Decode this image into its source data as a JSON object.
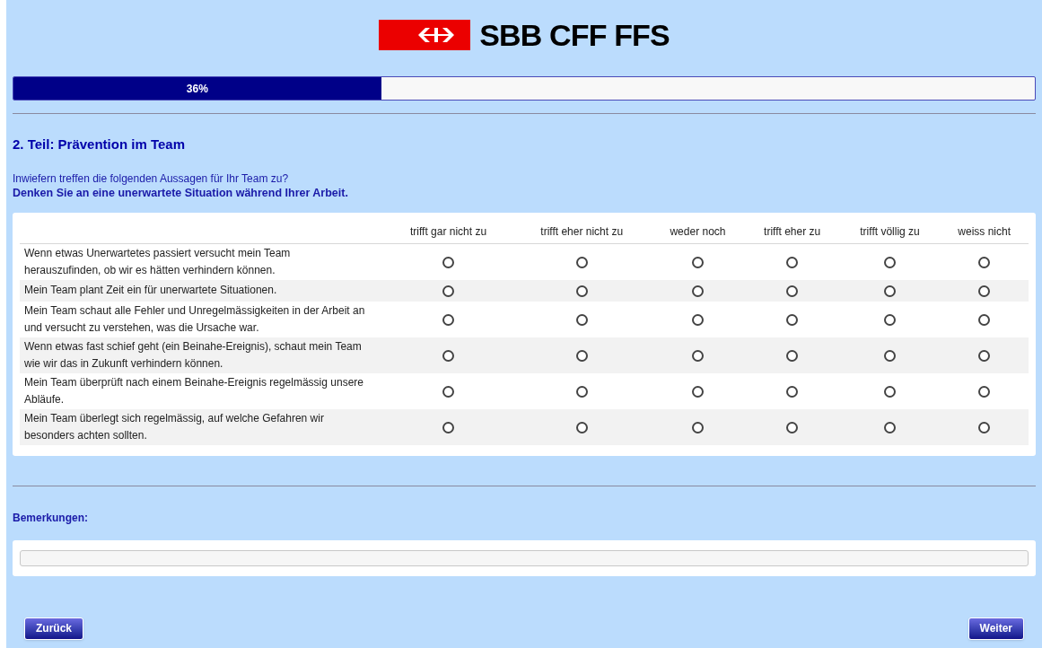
{
  "header": {
    "logo_text": "SBB CFF FFS"
  },
  "progress": {
    "level": 0.36,
    "label": "36%"
  },
  "section_title": "2. Teil: Prävention im Team",
  "question": "Inwiefern treffen die folgenden Aussagen für Ihr Team zu?",
  "instruction": "Denken Sie an eine unerwartete Situation während Ihrer Arbeit.",
  "table": {
    "columns": [
      "trifft gar nicht zu",
      "trifft eher nicht zu",
      "weder noch",
      "trifft eher zu",
      "trifft völlig zu",
      "weiss nicht"
    ],
    "rows": [
      {
        "statement": "Wenn etwas Unerwartetes passiert versucht mein Team herauszufinden, ob wir es hätten verhindern können.",
        "choices": [
          false,
          false,
          false,
          false,
          false,
          false
        ]
      },
      {
        "statement": "Mein Team plant Zeit ein für unerwartete Situationen.",
        "choices": [
          false,
          false,
          false,
          false,
          false,
          false
        ]
      },
      {
        "statement": "Mein Team schaut alle Fehler und Unregelmässigkeiten in der Arbeit an und versucht zu verstehen, was die Ursache war.",
        "choices": [
          false,
          false,
          false,
          false,
          false,
          false
        ]
      },
      {
        "statement": "Wenn etwas fast schief geht (ein Beinahe-Ereignis), schaut mein Team wie wir das in Zukunft verhindern können.",
        "choices": [
          false,
          false,
          false,
          false,
          false,
          false
        ]
      },
      {
        "statement": "Mein Team überprüft nach einem Beinahe-Ereignis regelmässig unsere Abläufe.",
        "choices": [
          false,
          false,
          false,
          false,
          false,
          false
        ]
      },
      {
        "statement": "Mein Team überlegt sich regelmässig, auf welche Gefahren wir besonders achten sollten.",
        "choices": [
          false,
          false,
          false,
          false,
          false,
          false
        ]
      }
    ]
  },
  "remarks": {
    "label": "Bemerkungen:"
  },
  "buttons": {
    "back": "Zurück",
    "next": "Weiter"
  }
}
